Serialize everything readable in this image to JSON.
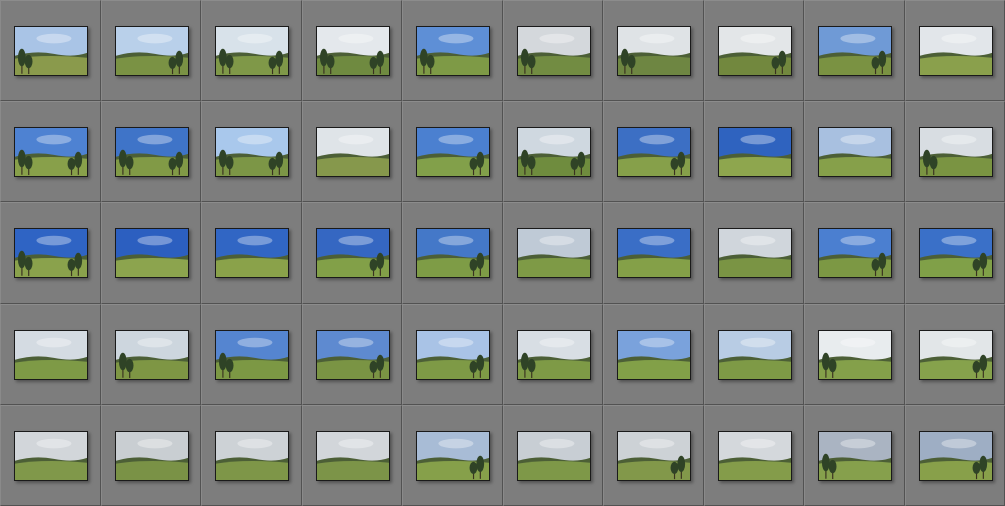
{
  "grid": {
    "columns": 10,
    "rows": 5,
    "thumbnails": [
      {
        "sky": "#a9c4e6",
        "ground": "#8a9a4c",
        "trees": "left"
      },
      {
        "sky": "#b9d0ea",
        "ground": "#7a9244",
        "trees": "right"
      },
      {
        "sky": "#d8e2ea",
        "ground": "#7f9848",
        "trees": "both"
      },
      {
        "sky": "#e4e8ec",
        "ground": "#6f8a40",
        "trees": "both"
      },
      {
        "sky": "#5e8fd6",
        "ground": "#7e9a46",
        "trees": "left"
      },
      {
        "sky": "#d4d8dc",
        "ground": "#728c42",
        "trees": "left"
      },
      {
        "sky": "#dfe3e6",
        "ground": "#6e8642",
        "trees": "left"
      },
      {
        "sky": "#e3e6e8",
        "ground": "#72883e",
        "trees": "right"
      },
      {
        "sky": "#6f9ad6",
        "ground": "#7a9242",
        "trees": "right"
      },
      {
        "sky": "#e2e6ea",
        "ground": "#8aa04c",
        "trees": "none"
      },
      {
        "sky": "#4e82d2",
        "ground": "#88a04a",
        "trees": "both"
      },
      {
        "sky": "#3f74c8",
        "ground": "#819a46",
        "trees": "both"
      },
      {
        "sky": "#a9c8ec",
        "ground": "#7c9646",
        "trees": "both"
      },
      {
        "sky": "#dfe4e8",
        "ground": "#86984c",
        "trees": "none"
      },
      {
        "sky": "#4b80d0",
        "ground": "#82a04a",
        "trees": "right"
      },
      {
        "sky": "#cfd8e0",
        "ground": "#6f8c3e",
        "trees": "both"
      },
      {
        "sky": "#3c6fc4",
        "ground": "#86a04a",
        "trees": "right"
      },
      {
        "sky": "#2f63bf",
        "ground": "#8ea64e",
        "trees": "none"
      },
      {
        "sky": "#a8c0e0",
        "ground": "#86a04a",
        "trees": "none"
      },
      {
        "sky": "#d8dde2",
        "ground": "#7a9442",
        "trees": "left"
      },
      {
        "sky": "#2f64c4",
        "ground": "#8aa24c",
        "trees": "both"
      },
      {
        "sky": "#2c5fc0",
        "ground": "#8ca44e",
        "trees": "none"
      },
      {
        "sky": "#3166c4",
        "ground": "#8aa24a",
        "trees": "none"
      },
      {
        "sky": "#3567c2",
        "ground": "#82a048",
        "trees": "right"
      },
      {
        "sky": "#4478c8",
        "ground": "#7e9c46",
        "trees": "right"
      },
      {
        "sky": "#bfcad6",
        "ground": "#7e9a46",
        "trees": "none"
      },
      {
        "sky": "#3a6ec6",
        "ground": "#84a048",
        "trees": "none"
      },
      {
        "sky": "#d0d6dc",
        "ground": "#7a9444",
        "trees": "none"
      },
      {
        "sky": "#4b7fd0",
        "ground": "#7c9844",
        "trees": "right"
      },
      {
        "sky": "#3a70c8",
        "ground": "#80a048",
        "trees": "right"
      },
      {
        "sky": "#d4dbe2",
        "ground": "#7e9a46",
        "trees": "none"
      },
      {
        "sky": "#cdd6de",
        "ground": "#7e9644",
        "trees": "left"
      },
      {
        "sky": "#5585d0",
        "ground": "#7c9844",
        "trees": "left"
      },
      {
        "sky": "#5e8ad0",
        "ground": "#7a9444",
        "trees": "right"
      },
      {
        "sky": "#a9c3e6",
        "ground": "#7e9a46",
        "trees": "right"
      },
      {
        "sky": "#d8dee4",
        "ground": "#7e9a46",
        "trees": "left"
      },
      {
        "sky": "#7aa2dc",
        "ground": "#82a048",
        "trees": "none"
      },
      {
        "sky": "#b8cce4",
        "ground": "#7e9a46",
        "trees": "none"
      },
      {
        "sky": "#e8ecee",
        "ground": "#84a04a",
        "trees": "left"
      },
      {
        "sky": "#e2e6e8",
        "ground": "#86a24c",
        "trees": "right"
      },
      {
        "sky": "#d2d6da",
        "ground": "#80984a",
        "trees": "none"
      },
      {
        "sky": "#c9ced2",
        "ground": "#7a9246",
        "trees": "none"
      },
      {
        "sky": "#cdd2d6",
        "ground": "#7e9648",
        "trees": "none"
      },
      {
        "sky": "#d2d6da",
        "ground": "#7c9448",
        "trees": "none"
      },
      {
        "sky": "#a8bcd6",
        "ground": "#86a04a",
        "trees": "right"
      },
      {
        "sky": "#c8ced4",
        "ground": "#7e9848",
        "trees": "none"
      },
      {
        "sky": "#cdd2d6",
        "ground": "#82984a",
        "trees": "right"
      },
      {
        "sky": "#d4d8dc",
        "ground": "#849c4a",
        "trees": "none"
      },
      {
        "sky": "#aab4c2",
        "ground": "#86a04c",
        "trees": "left"
      },
      {
        "sky": "#9eaec4",
        "ground": "#88a04a",
        "trees": "right"
      }
    ]
  }
}
